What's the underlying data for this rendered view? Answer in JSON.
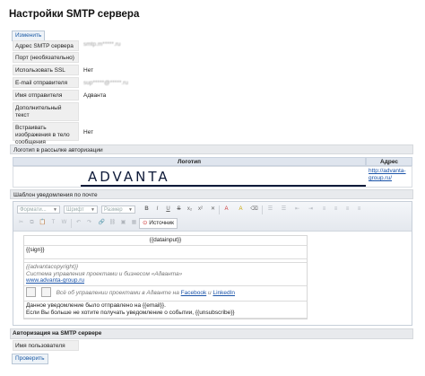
{
  "page": {
    "title": "Настройки SMTP сервера",
    "edit_button": "Изменить"
  },
  "smtp": {
    "rows": [
      {
        "label": "Адрес SMTP сервера",
        "value": "smtp.m*****.ru",
        "blurred": true
      },
      {
        "label": "Порт (необязательно)",
        "value": ""
      },
      {
        "label": "Использовать SSL",
        "value": "Нет"
      },
      {
        "label": "E-mail отправителя",
        "value": "sup*****@*****.ru",
        "blurred": true
      },
      {
        "label": "Имя отправителя",
        "value": "Адванта"
      },
      {
        "label": "Дополнительный текст",
        "value": ""
      },
      {
        "label": "Встраивать изображения в тело сообщения",
        "value": "Нет"
      }
    ]
  },
  "logo_section": {
    "title": "Логотип в рассылке авторизации",
    "col_logo": "Логотип",
    "col_address": "Адрес",
    "logo_text": "ADVANTA",
    "address": "http://advanta-group.ru/"
  },
  "template_section": {
    "title": "Шаблон уведомления по почте",
    "toolbar": {
      "format": "Формати...",
      "font": "Шрифт",
      "size": "Размер",
      "source": "Источник"
    },
    "email": {
      "datainput": "{{datainput}}",
      "sign": "{{sign}}",
      "copyright": "{{advantacopyright}}",
      "tagline": "Система управления проектами и бизнесом «Адванта»",
      "site": "www.advanta-group.ru",
      "social_prefix": "Всё об управлении проектами в Адванте на",
      "facebook": "Facebook",
      "and": "и",
      "linkedin": "LinkedIn",
      "note1": "Данное уведомление было отправлено на {{email}}.",
      "note2": "Если Вы больше не хотите получать уведомление о событии, {{unsubscribe}}"
    }
  },
  "auth_section": {
    "title": "Авторизация на SMTP сервере",
    "username_label": "Имя пользователя",
    "check_button": "Проверить"
  }
}
